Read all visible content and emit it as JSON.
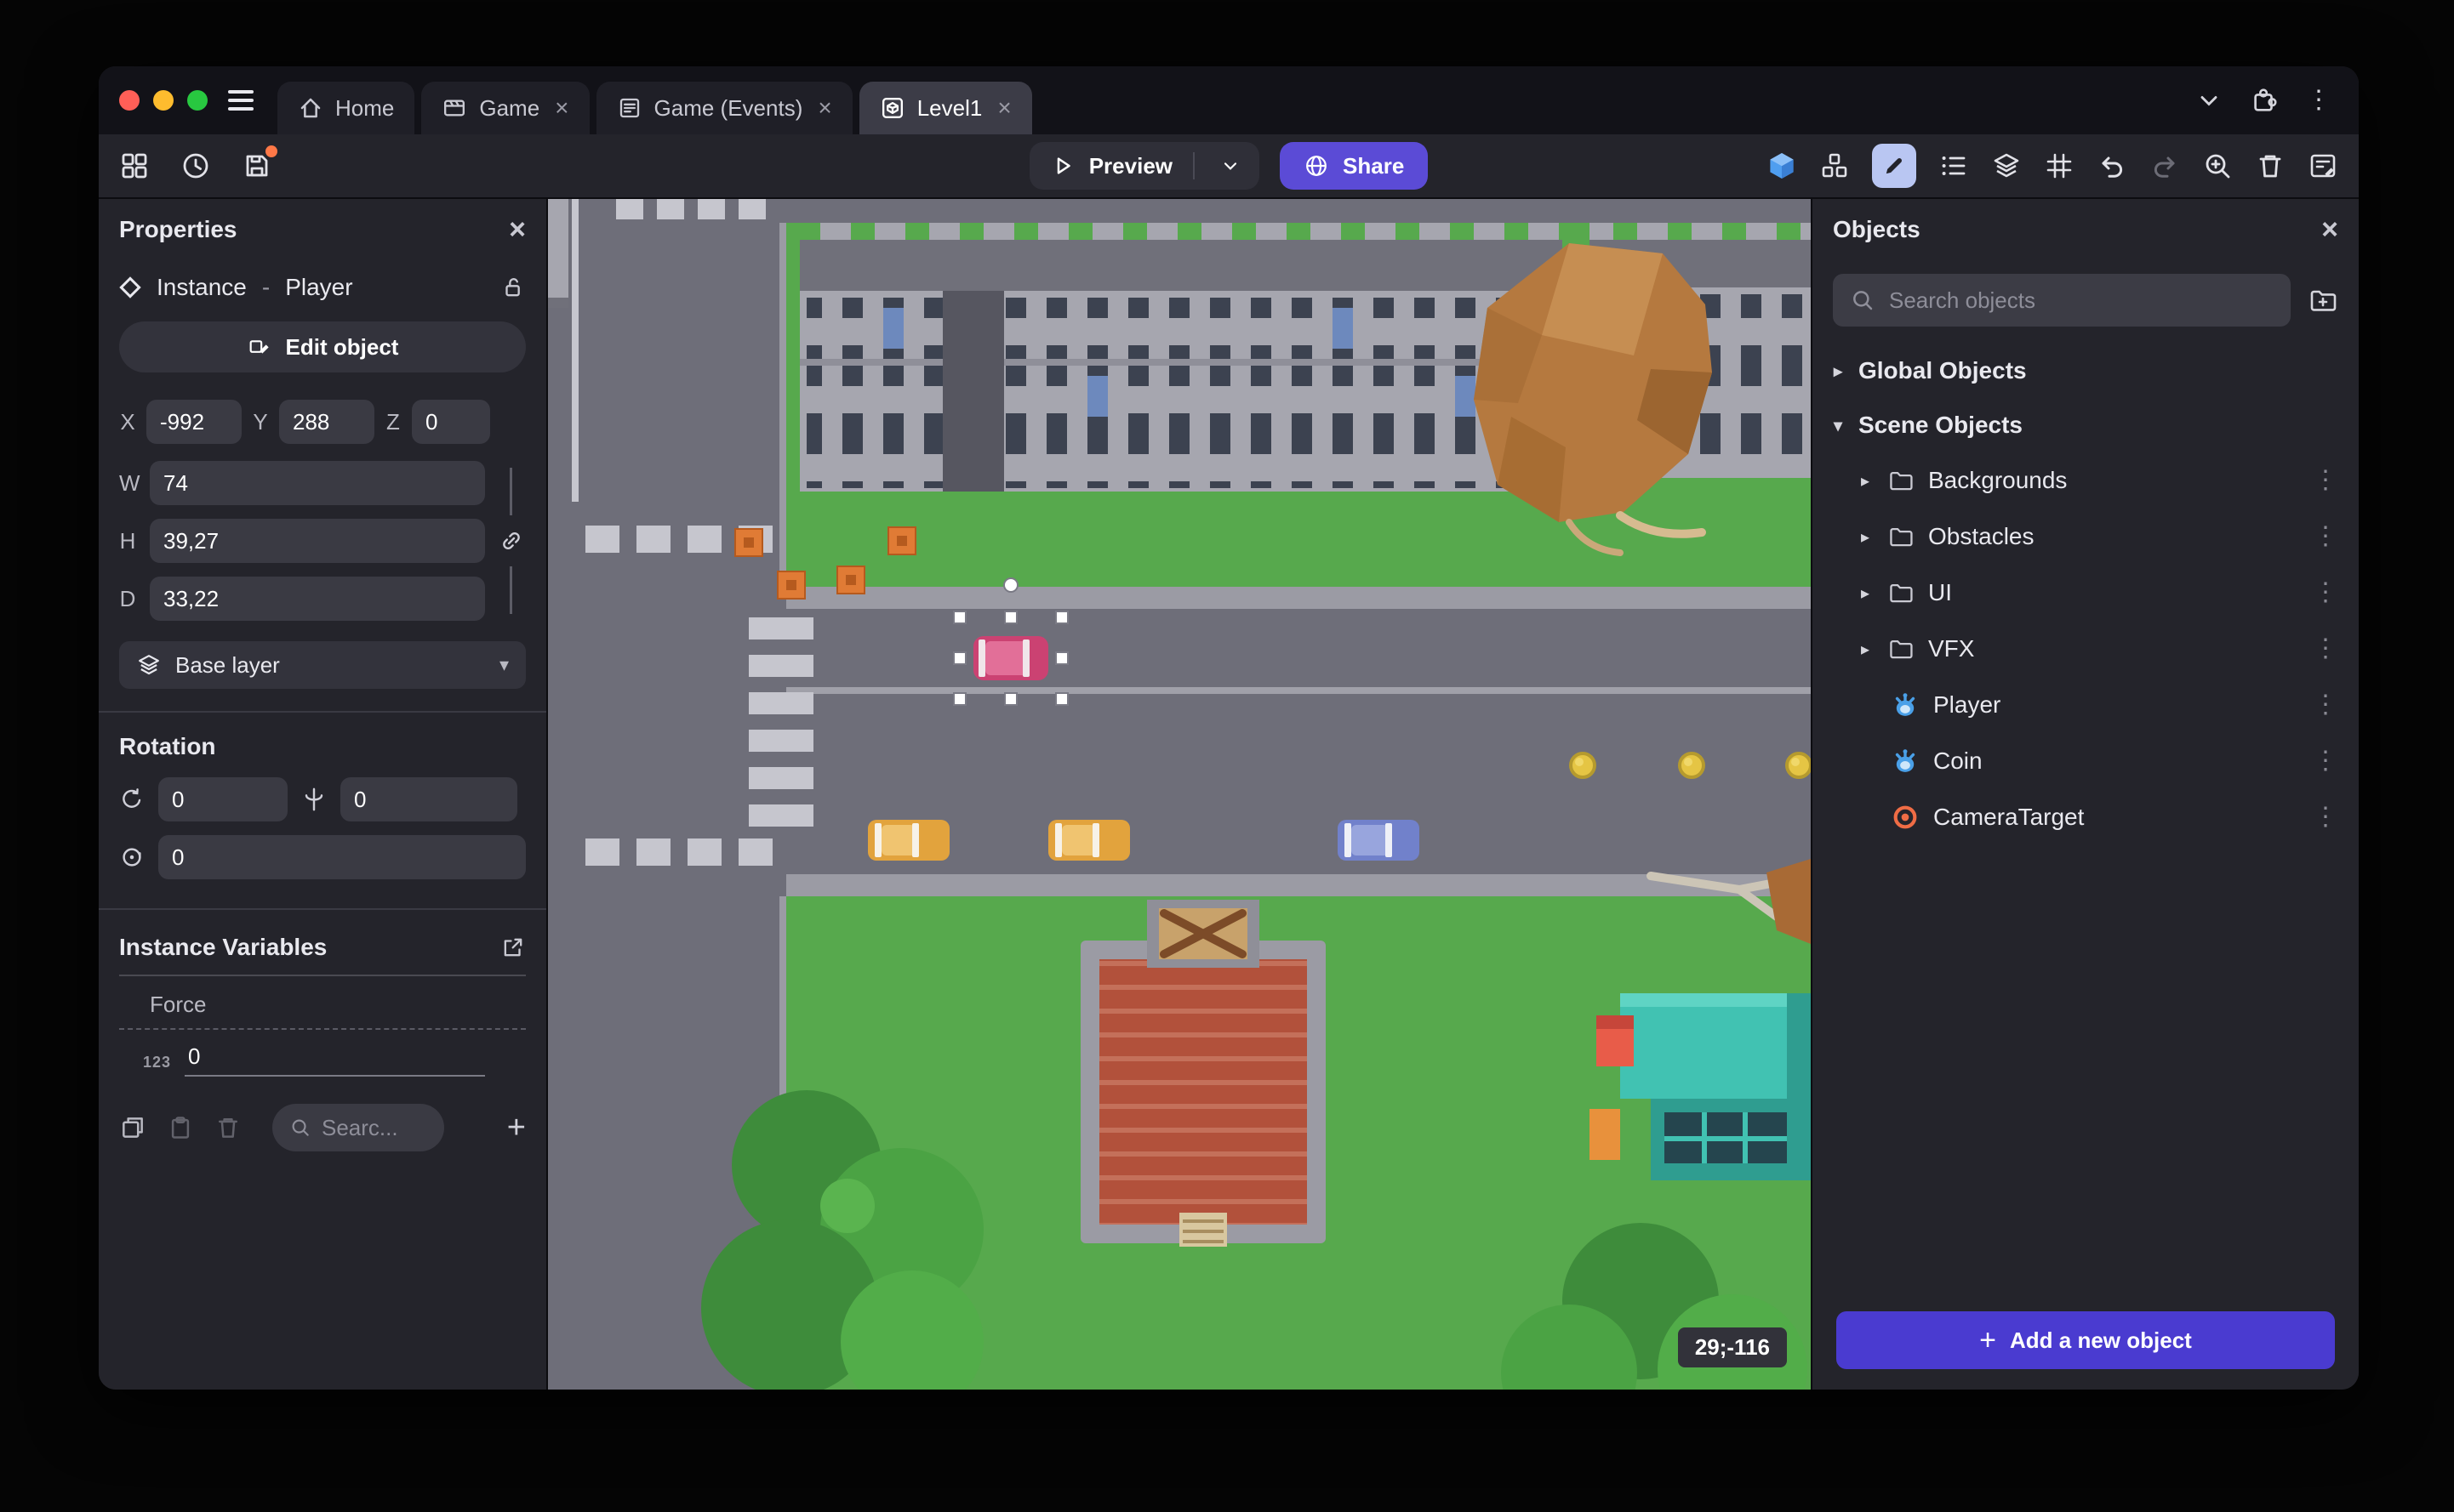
{
  "glyphs": {
    "close": "×",
    "kebab": "⋮",
    "chevron_right": "▸",
    "chevron_down": "▾",
    "plus": "+"
  },
  "colors": {
    "accent_purple": "#5b4bd6",
    "add_button_purple": "#4a3bd0",
    "accent_blue": "#4f9ef0",
    "active_tool_blue": "#b9c6f2",
    "notification_orange": "#ff7847",
    "traffic_red": "#ff5f57",
    "traffic_yellow": "#febc2e",
    "traffic_green": "#28c840"
  },
  "titlebar": {
    "tabs": [
      {
        "label": "Home"
      },
      {
        "label": "Game"
      },
      {
        "label": "Game (Events)"
      },
      {
        "label": "Level1"
      }
    ]
  },
  "toolbar": {
    "preview": "Preview",
    "share": "Share"
  },
  "properties": {
    "title": "Properties",
    "instance_type": "Instance",
    "separator": "-",
    "instance_name": "Player",
    "edit_object": "Edit object",
    "x_label": "X",
    "x": "-992",
    "y_label": "Y",
    "y": "288",
    "z_label": "Z",
    "z": "0",
    "w_label": "W",
    "w": "74",
    "h_label": "H",
    "h": "39,27",
    "d_label": "D",
    "d": "33,22",
    "layer": "Base layer",
    "rotation_title": "Rotation",
    "rot_x": "0",
    "rot_y": "0",
    "rot_z": "0",
    "variables_title": "Instance Variables",
    "variable_name": "Force",
    "variable_type": "123",
    "variable_value": "0",
    "search_placeholder": "Searc..."
  },
  "canvas": {
    "coordinates": "29;-116"
  },
  "objects": {
    "title": "Objects",
    "search_placeholder": "Search objects",
    "global_group": "Global Objects",
    "scene_group": "Scene Objects",
    "folders": [
      {
        "name": "Backgrounds"
      },
      {
        "name": "Obstacles"
      },
      {
        "name": "UI"
      },
      {
        "name": "VFX"
      }
    ],
    "items": [
      {
        "name": "Player"
      },
      {
        "name": "Coin"
      },
      {
        "name": "CameraTarget"
      }
    ],
    "add_button": "Add a new object"
  }
}
